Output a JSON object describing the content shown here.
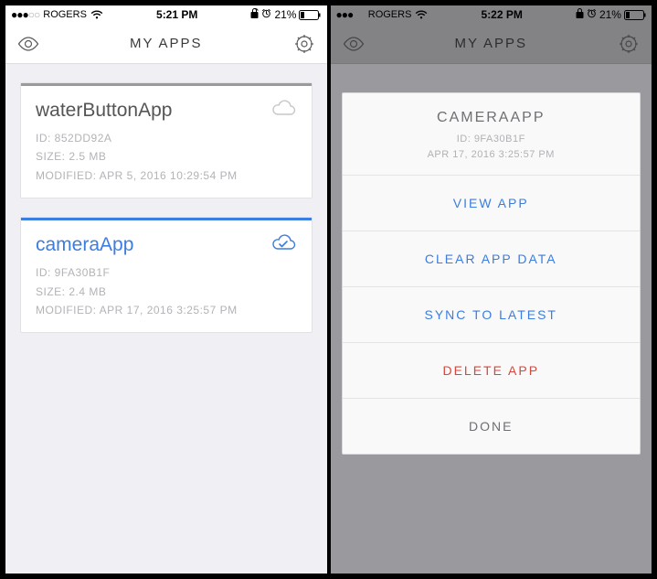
{
  "left": {
    "status": {
      "carrier": "ROGERS",
      "time": "5:21 PM",
      "battery": "21%"
    },
    "nav": {
      "title": "MY APPS"
    },
    "cards": [
      {
        "title": "waterButtonApp",
        "id": "ID: 852DD92A",
        "size": "SIZE: 2.5 MB",
        "modified": "MODIFIED: APR 5, 2016 10:29:54 PM"
      },
      {
        "title": "cameraApp",
        "id": "ID: 9FA30B1F",
        "size": "SIZE: 2.4 MB",
        "modified": "MODIFIED: APR 17, 2016 3:25:57 PM"
      }
    ]
  },
  "right": {
    "status": {
      "carrier": "ROGERS",
      "time": "5:22 PM",
      "battery": "21%"
    },
    "nav": {
      "title": "MY APPS"
    },
    "sheet": {
      "title": "CAMERAAPP",
      "id": "ID: 9FA30B1F",
      "date": "APR 17, 2016 3:25:57 PM",
      "actions": {
        "view": "VIEW APP",
        "clear": "CLEAR APP DATA",
        "sync": "SYNC TO LATEST",
        "delete": "DELETE APP",
        "done": "DONE"
      }
    }
  }
}
